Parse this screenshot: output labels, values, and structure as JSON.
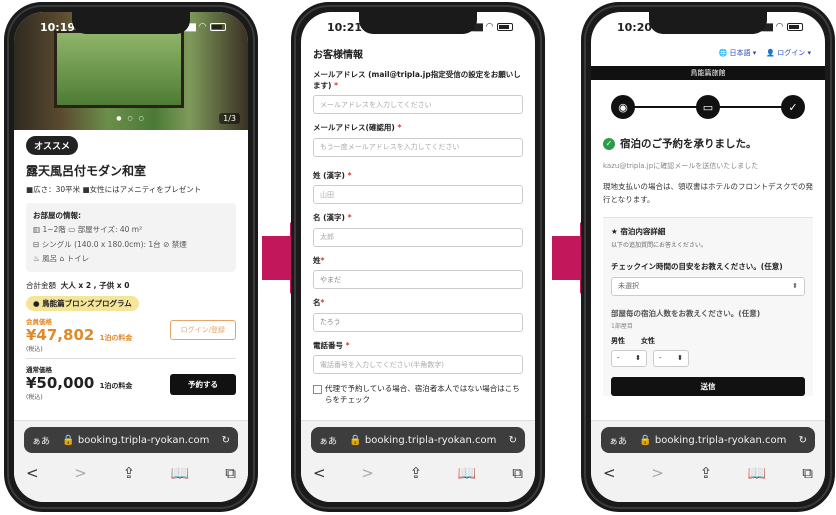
{
  "colors": {
    "arrow": "#c2185b",
    "accent_orange": "#e08a2a",
    "success_green": "#2e9b4a",
    "lang_blue": "#2448b8"
  },
  "browser": {
    "aa": "ぁあ",
    "url": "booking.tripla-ryokan.com",
    "lock_icon": "🔒",
    "reload_icon": "↻",
    "toolbar": {
      "back": "<",
      "forward": ">",
      "share": "⇪",
      "bookmarks": "📖",
      "tabs": "⧉"
    }
  },
  "phone1": {
    "time": "10:19",
    "photo_counter": "1/3",
    "badge": "オススメ",
    "room_title": "露天風呂付モダン和室",
    "room_sub": "■広さ：30平米 ■女性にはアメニティをプレゼント",
    "info_heading": "お部屋の情報:",
    "info_floor": "1~2階",
    "info_size": "部屋サイズ: 40 m²",
    "info_bed": "シングル (140.0 x 180.0cm): 1台",
    "info_smoking": "禁煙",
    "info_bath": "風呂",
    "info_toilet": "トイレ",
    "total_label": "合計金額",
    "total_value": "大人 x 2 , 子供 x 0",
    "program": "鳥能篇ブロンズプログラム",
    "member_label": "会員価格",
    "member_price": "¥47,802",
    "member_price_suffix": "1泊の料金",
    "member_tax": "(税込)",
    "login_button": "ログイン/登録",
    "normal_label": "通常価格",
    "normal_price": "¥50,000",
    "normal_price_suffix": "1泊の料金",
    "normal_tax": "(税込)",
    "reserve_button": "予約する"
  },
  "phone2": {
    "time": "10:21",
    "section_title": "お客様情報",
    "email_label": "メールアドレス (mail@tripla.jp指定受信の設定をお願いします)",
    "email_placeholder": "メールアドレスを入力してください",
    "email_confirm_label": "メールアドレス(確認用)",
    "email_confirm_placeholder": "もう一度メールアドレスを入力してください",
    "last_name_kanji_label": "姓 (漢字)",
    "last_name_kanji_value": "山田",
    "first_name_kanji_label": "名 (漢字)",
    "first_name_kanji_value": "太郎",
    "last_name_label": "姓",
    "last_name_value": "やまだ",
    "first_name_label": "名",
    "first_name_value": "たろう",
    "phone_label": "電話番号",
    "phone_placeholder": "電話番号を入力してください(半角数字)",
    "proxy_check_label": "代理で予約している場合、宿泊者本人ではない場合はこちらをチェック",
    "required_mark": "*"
  },
  "phone3": {
    "time": "10:20",
    "language": "日本語 ▾",
    "login": "ログイン ▾",
    "logo_text": "鳥能篇旅館",
    "steps": [
      "◉",
      "▭",
      "✓"
    ],
    "confirm_title": "宿泊のご予約を承りました。",
    "email_note": "kazu@tripla.jpに確認メールを送信いたしました",
    "payment_note": "現地支払いの場合は、領収書はホテルのフロントデスクでの発行となります。",
    "details_heading": "★ 宿泊内容詳細",
    "details_sub": "以下の追加質問にお答えください。",
    "q_checkin": "チェックイン時間の目安をお教えください。(任意)",
    "checkin_select": "未選択",
    "q_people": "部屋毎の宿泊人数をお教えください。(任意)",
    "room1": "1部屋目",
    "male": "男性",
    "female": "女性",
    "male_value": "-",
    "female_value": "-",
    "submit": "送信"
  }
}
